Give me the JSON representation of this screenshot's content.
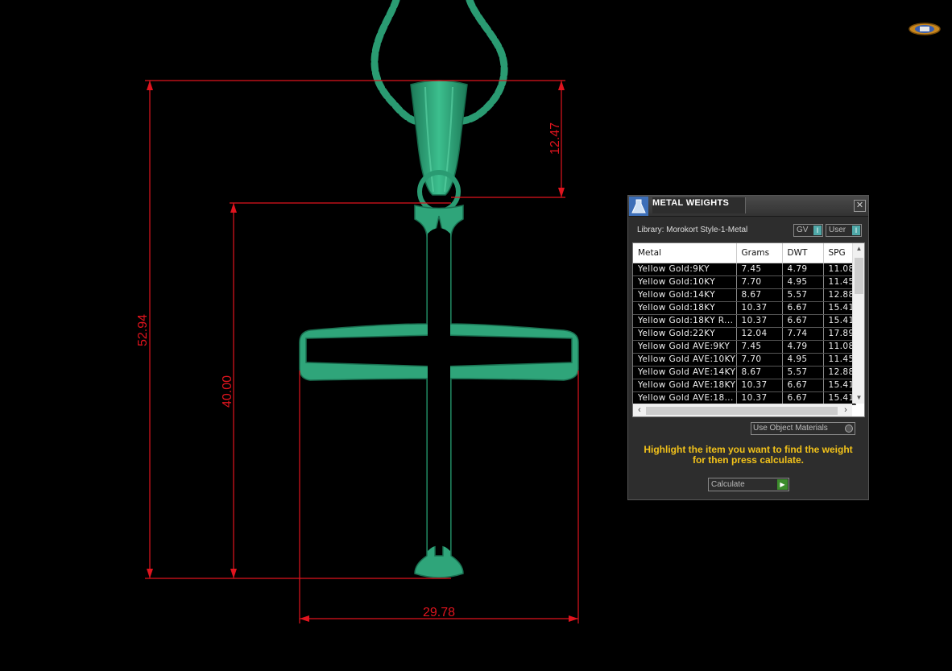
{
  "dimensions": {
    "total_height": "52.94",
    "cross_height": "40.00",
    "bail_height": "12.47",
    "cross_width": "29.78"
  },
  "colors": {
    "dimension_line": "#e0141e",
    "model": "#2fa57a",
    "hint_text": "#f2c21a"
  },
  "panel": {
    "title": "METAL WEIGHTS",
    "close_icon": "close-icon",
    "library_label": "Library: Morokort Style-1-Metal",
    "toggle_gv": "GV",
    "toggle_user": "User",
    "table": {
      "headers": [
        "Metal",
        "Grams",
        "DWT",
        "SPG"
      ],
      "rows": [
        [
          "Yellow Gold:9KY",
          "7.45",
          "4.79",
          "11.08"
        ],
        [
          "Yellow Gold:10KY",
          "7.70",
          "4.95",
          "11.45"
        ],
        [
          "Yellow Gold:14KY",
          "8.67",
          "5.57",
          "12.88"
        ],
        [
          "Yellow Gold:18KY",
          "10.37",
          "6.67",
          "15.41"
        ],
        [
          "Yellow Gold:18KY R...",
          "10.37",
          "6.67",
          "15.41"
        ],
        [
          "Yellow Gold:22KY",
          "12.04",
          "7.74",
          "17.89"
        ],
        [
          "Yellow Gold AVE:9KY",
          "7.45",
          "4.79",
          "11.08"
        ],
        [
          "Yellow Gold AVE:10KY",
          "7.70",
          "4.95",
          "11.45"
        ],
        [
          "Yellow Gold AVE:14KY",
          "8.67",
          "5.57",
          "12.88"
        ],
        [
          "Yellow Gold AVE:18KY",
          "10.37",
          "6.67",
          "15.41"
        ],
        [
          "Yellow Gold AVE:18...",
          "10.37",
          "6.67",
          "15.41"
        ]
      ]
    },
    "use_object_materials": "Use Object Materials",
    "hint_line1": "Highlight the item you want to find the weight",
    "hint_line2": "for then press calculate.",
    "calculate_label": "Calculate"
  }
}
